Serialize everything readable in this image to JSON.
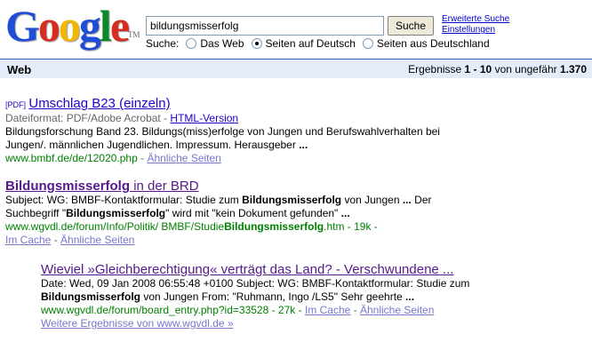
{
  "logo": {
    "letters": [
      "G",
      "o",
      "o",
      "g",
      "l",
      "e"
    ],
    "colors": [
      "#1f4dd8",
      "#d62d20",
      "#f2b700",
      "#1f4dd8",
      "#0a8a2d",
      "#d62d20"
    ],
    "tm": "TM"
  },
  "search": {
    "value": "bildungsmisserfolg",
    "button": "Suche",
    "advanced": "Erweiterte Suche",
    "settings": "Einstellungen"
  },
  "scope": {
    "label": "Suche:",
    "options": [
      "Das Web",
      "Seiten auf Deutsch",
      "Seiten aus Deutschland"
    ],
    "selected": "Seiten auf Deutsch"
  },
  "bar": {
    "label": "Web",
    "prefix": "Ergebnisse ",
    "range": "1 - 10",
    "mid": " von ungefähr ",
    "total": "1.370"
  },
  "results": [
    {
      "tag": "[PDF]",
      "title": "Umschlag B23 (einzeln)",
      "format_label": "Dateiformat: PDF/Adobe Acrobat - ",
      "html_version": "HTML-Version",
      "snippet1": "Bildungsforschung Band 23. Bildungs(miss)erfolge von Jungen und Berufswahlverhalten bei",
      "snippet2": "Jungen/. männlichen Jugendlichen. Impressum. Herausgeber ",
      "ellipsis": "...",
      "url": "www.bmbf.de/de/12020.php",
      "sep": " - ",
      "similar": "Ähnliche Seiten"
    },
    {
      "title_bold": "Bildungsmisserfolg",
      "title_rest": " in der BRD",
      "s1a": "Subject: WG: BMBF-Kontaktformular: Studie zum ",
      "s1b": "Bildungsmisserfolg",
      "s1c": " von Jungen ",
      "s1d": "...",
      "s1e": " Der",
      "s2a": "Suchbegriff \"",
      "s2b": "Bildungsmisserfolg",
      "s2c": "\" wird mit \"kein Dokument gefunden\" ",
      "s2d": "...",
      "url_a": "www.wgvdl.de/forum/Info/Politik/ BMBF/Studie",
      "url_b": "Bildungsmisserfolg",
      "url_c": ".htm - 19k - ",
      "cache": "Im Cache",
      "sep": " - ",
      "similar": "Ähnliche Seiten"
    },
    {
      "title": "Wieviel »Gleichberechtigung« verträgt das Land? - Verschwundene ...",
      "s1": "Date: Wed, 09 Jan 2008 06:55:48 +0100 Subject: WG: BMBF-Kontaktformular: Studie zum",
      "s2a": "Bildungsmisserfolg",
      "s2b": " von Jungen From: \"Ruhmann, Ingo /LS5\" Sehr geehrte ",
      "s2c": "...",
      "url": "www.wgvdl.de/forum/board_entry.php?id=33528 - 27k - ",
      "cache": "Im Cache",
      "sep": " - ",
      "similar": "Ähnliche Seiten",
      "more": "Weitere Ergebnisse von www.wgvdl.de »"
    }
  ]
}
